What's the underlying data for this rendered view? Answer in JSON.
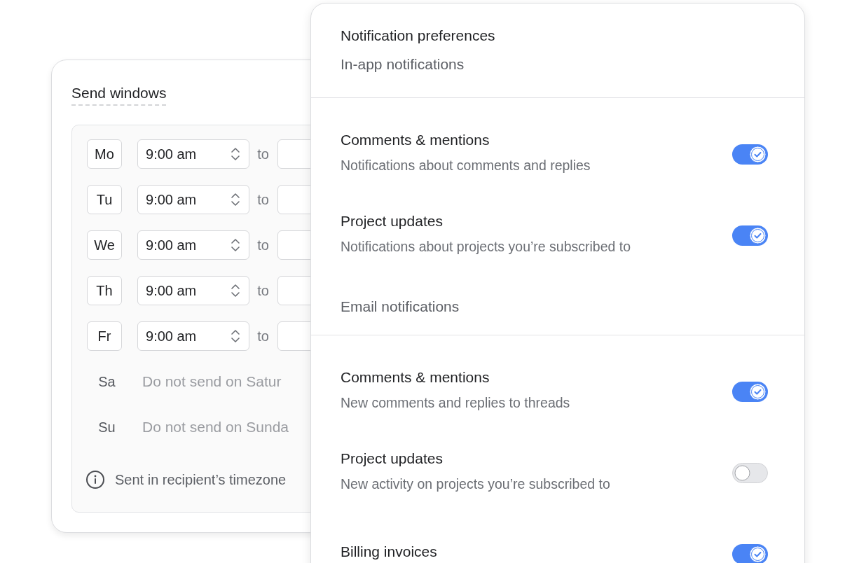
{
  "send_windows": {
    "title": "Send windows",
    "days": [
      {
        "day": "Mo",
        "kind": "range",
        "start": "9:00 am",
        "to": "to"
      },
      {
        "day": "Tu",
        "kind": "range",
        "start": "9:00 am",
        "to": "to"
      },
      {
        "day": "We",
        "kind": "range",
        "start": "9:00 am",
        "to": "to"
      },
      {
        "day": "Th",
        "kind": "range",
        "start": "9:00 am",
        "to": "to"
      },
      {
        "day": "Fr",
        "kind": "range",
        "start": "9:00 am",
        "to": "to"
      },
      {
        "day": "Sa",
        "kind": "off",
        "note": "Do not send on Satur"
      },
      {
        "day": "Su",
        "kind": "off",
        "note": "Do not send on Sunda"
      }
    ],
    "footnote": "Sent in recipient’s timezone"
  },
  "notifications": {
    "title": "Notification preferences",
    "sections": [
      {
        "heading": "In-app notifications",
        "items": [
          {
            "title": "Comments & mentions",
            "description": "Notifications about comments and replies",
            "on": true
          },
          {
            "title": "Project updates",
            "description": "Notifications about projects you’re subscribed to",
            "on": true
          }
        ]
      },
      {
        "heading": "Email notifications",
        "items": [
          {
            "title": "Comments & mentions",
            "description": "New comments and replies to threads",
            "on": true
          },
          {
            "title": "Project updates",
            "description": "New activity on projects you’re subscribed to",
            "on": false
          },
          {
            "title": "Billing invoices",
            "on": true
          }
        ]
      }
    ]
  }
}
